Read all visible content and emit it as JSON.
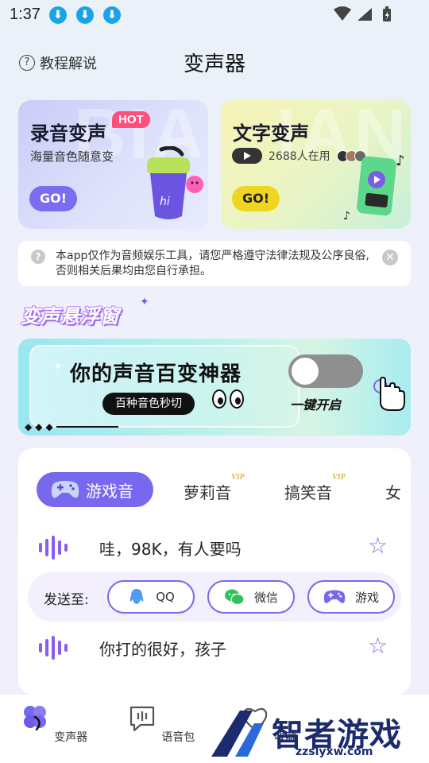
{
  "status_bar": {
    "time": "1:37"
  },
  "header": {
    "help_label": "教程解说",
    "title": "变声器"
  },
  "cards": {
    "record": {
      "title": "录音变声",
      "subtitle": "海量音色随意变",
      "badge": "HOT",
      "go_label": "GO!",
      "bg_letters": "BIAN"
    },
    "text": {
      "title": "文字变声",
      "users": "2688人在用",
      "go_label": "GO!",
      "bg_letters": "IANS"
    }
  },
  "notice": {
    "text": "本app仅作为音频娱乐工具，请您严格遵守法律法规及公序良俗,否则相关后果均由您自行承担。"
  },
  "floating": {
    "section_title": "变声悬浮窗",
    "banner_title": "你的声音百变神器",
    "banner_pill": "百种音色秒切",
    "toggle_label": "一键开启",
    "toggle_on": false
  },
  "sound_panel": {
    "tabs": [
      {
        "label": "游戏音",
        "active": true
      },
      {
        "label": "萝莉音",
        "vip": "VIP"
      },
      {
        "label": "搞笑音",
        "vip": "VIP"
      },
      {
        "label": "女"
      }
    ],
    "sounds": [
      {
        "text": "哇，98K，有人要吗"
      },
      {
        "text": "你打的很好，孩子"
      }
    ],
    "send_to": {
      "label": "发送至:",
      "targets": [
        {
          "label": "QQ",
          "icon": "qq-icon"
        },
        {
          "label": "微信",
          "icon": "wechat-icon"
        },
        {
          "label": "游戏",
          "icon": "gamepad-icon"
        }
      ]
    }
  },
  "bottom_nav": [
    {
      "label": "变声器",
      "icon": "voice-changer-icon",
      "active": true
    },
    {
      "label": "语音包",
      "icon": "voice-pack-icon"
    },
    {
      "label": "收藏",
      "icon": "favorite-icon"
    }
  ],
  "watermark": {
    "text": "智者游戏网",
    "url": "zzslyxw.com"
  },
  "colors": {
    "accent": "#7868ee",
    "hot": "#ff4f7b",
    "go_yellow": "#f0d520"
  }
}
